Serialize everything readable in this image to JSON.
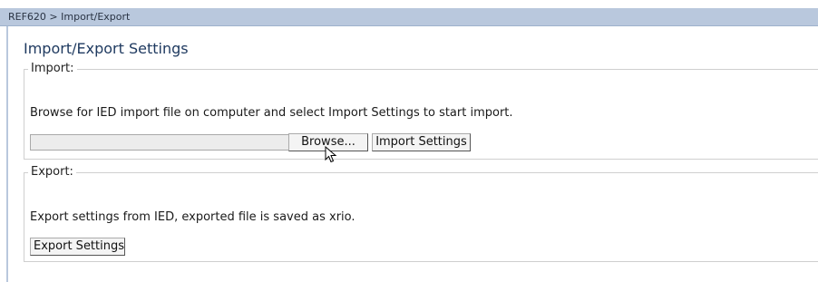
{
  "breadcrumb": {
    "text": "REF620 > Import/Export"
  },
  "page": {
    "title": "Import/Export Settings"
  },
  "import": {
    "legend": "Import:",
    "description": "Browse for IED import file on computer and select Import Settings to start import.",
    "file_input_value": "",
    "browse_label": "Browse...",
    "import_button_label": "Import Settings"
  },
  "export": {
    "legend": "Export:",
    "description": "Export settings from IED, exported file is saved as xrio.",
    "export_button_label": "Export Settings"
  },
  "colors": {
    "header_bar": "#b9c8dd",
    "title_text": "#1f3a60"
  }
}
